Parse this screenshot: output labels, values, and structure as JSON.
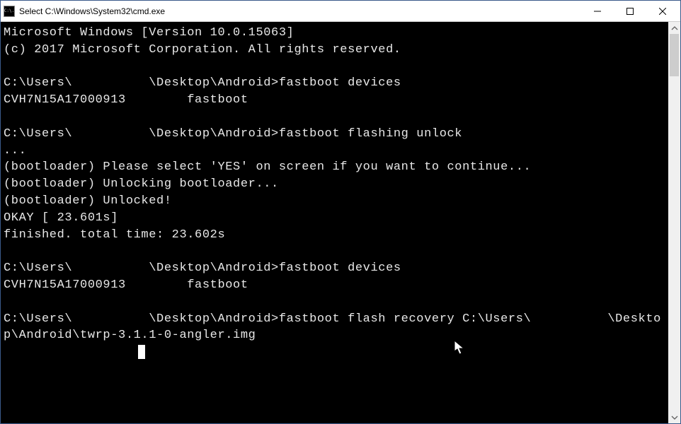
{
  "window": {
    "title": "Select C:\\Windows\\System32\\cmd.exe",
    "icon_label": "C:\\."
  },
  "terminal": {
    "lines": [
      "Microsoft Windows [Version 10.0.15063]",
      "(c) 2017 Microsoft Corporation. All rights reserved.",
      "",
      "C:\\Users\\          \\Desktop\\Android>fastboot devices",
      "CVH7N15A17000913        fastboot",
      "",
      "C:\\Users\\          \\Desktop\\Android>fastboot flashing unlock",
      "...",
      "(bootloader) Please select 'YES' on screen if you want to continue...",
      "(bootloader) Unlocking bootloader...",
      "(bootloader) Unlocked!",
      "OKAY [ 23.601s]",
      "finished. total time: 23.602s",
      "",
      "C:\\Users\\          \\Desktop\\Android>fastboot devices",
      "CVH7N15A17000913        fastboot",
      "",
      "C:\\Users\\          \\Desktop\\Android>fastboot flash recovery C:\\Users\\          \\Desktop\\Android\\twrp-3.1.1-0-angler.img"
    ]
  }
}
